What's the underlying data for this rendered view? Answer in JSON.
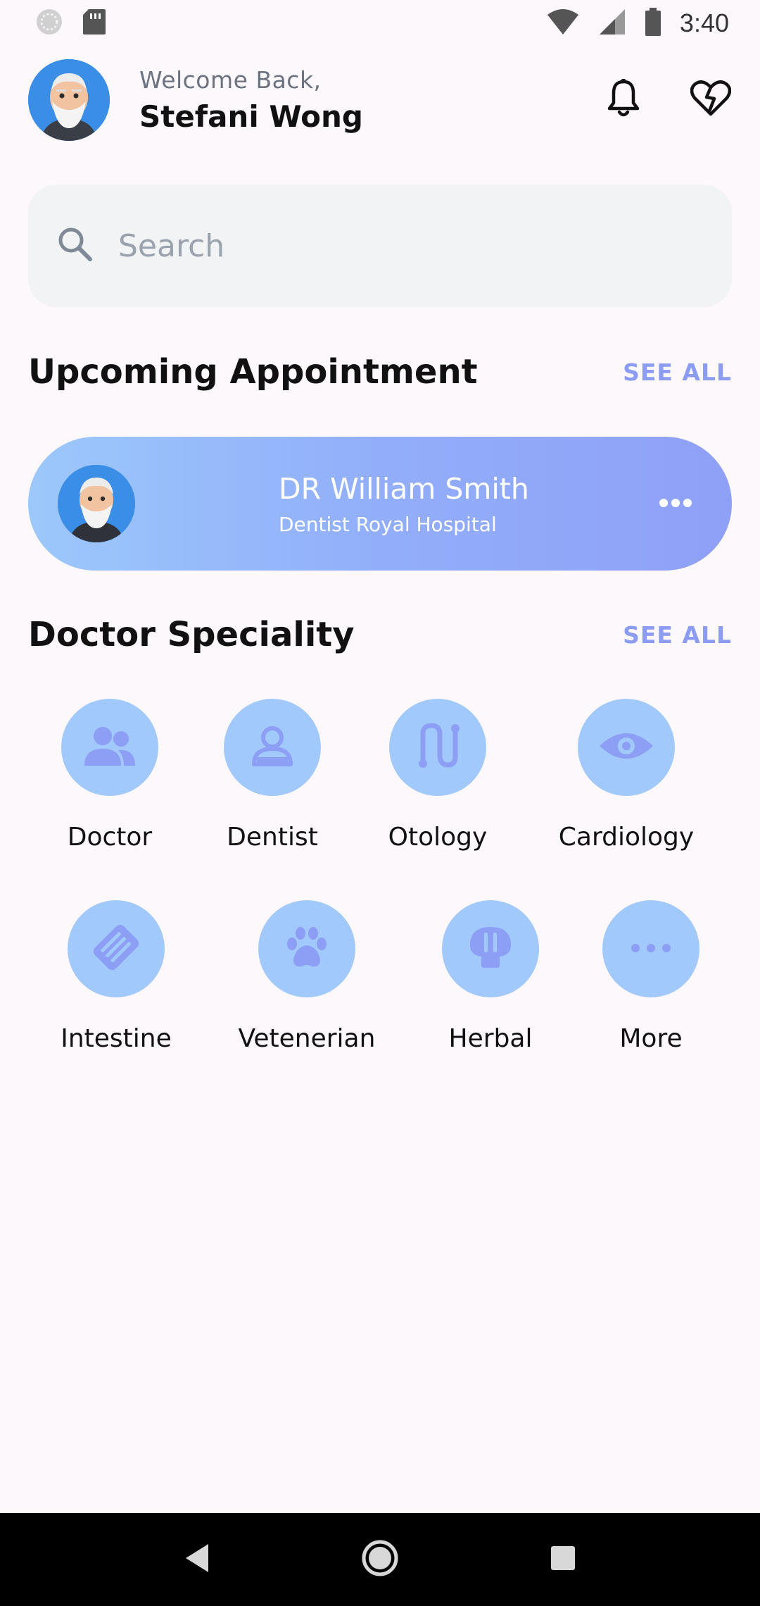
{
  "status_bar": {
    "time": "3:40"
  },
  "header": {
    "greeting": "Welcome Back,",
    "user_name": "Stefani Wong"
  },
  "search": {
    "placeholder": "Search"
  },
  "appointments": {
    "title": "Upcoming Appointment",
    "see_all": "SEE ALL",
    "card": {
      "doctor_name": "DR William Smith",
      "subtitle": "Dentist Royal Hospital"
    }
  },
  "speciality": {
    "title": "Doctor Speciality",
    "see_all": "SEE ALL",
    "items": [
      {
        "label": "Doctor",
        "icon": "people-icon"
      },
      {
        "label": "Dentist",
        "icon": "person-badge-icon"
      },
      {
        "label": "Otology",
        "icon": "ear-icon"
      },
      {
        "label": "Cardiology",
        "icon": "eye-icon"
      },
      {
        "label": "Intestine",
        "icon": "intestine-icon"
      },
      {
        "label": "Vetenerian",
        "icon": "paw-icon"
      },
      {
        "label": "Herbal",
        "icon": "herbal-icon"
      },
      {
        "label": "More",
        "icon": "more-icon"
      }
    ]
  },
  "colors": {
    "accent": "#8b9cf2",
    "icon_bg": "#a2c9fb",
    "icon_fg": "#8d9ef5",
    "background": "#fdf8fc"
  }
}
